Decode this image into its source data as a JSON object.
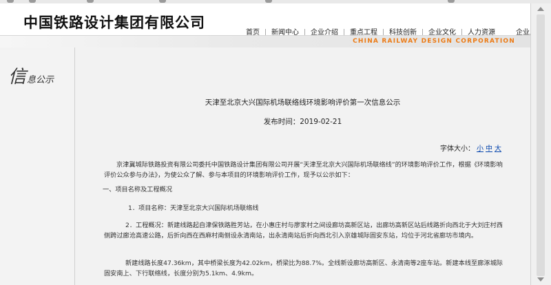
{
  "header": {
    "logo_text": "中国铁路设计集团有限公司",
    "nav": [
      "首页",
      "新闻中心",
      "企业介绍",
      "重点工程",
      "科技创新",
      "企业文化",
      "人力资源",
      "企业应用"
    ],
    "tagline": "CHINA RAILWAY DESIGN CORPORATION"
  },
  "sidebar": {
    "title_big": "信",
    "title_small": "息公示"
  },
  "article": {
    "title": "天津至北京大兴国际机场联络线环境影响评价第一次信息公示",
    "date": "发布时间：2019-02-21",
    "font_size_label": "字体大小：",
    "font_size_options": [
      "小",
      "中",
      "大"
    ],
    "paragraphs": [
      "京津冀城际铁路投资有限公司委托中国铁路设计集团有限公司开展“天津至北京大兴国际机场联络线”的环境影响评价工作，根据《环境影响评价公众参与办法》，为使公众了解、参与本项目的环境影响评价工作，现予以公示如下：",
      "一、项目名称及工程概况",
      "1．项目名称：天津至北京大兴国际机场联络线",
      "2．工程概况：新建线路起自津保铁路胜芳站，在小惠庄村与廖家村之间设廊坊高新区站，出廊坊高新区站后线路折向西北于大刘庄村西侧跨过廊沧高速公路，后折向西在西麻村南侧设永清南站，出永清南站后折向西北引入京雄城际固安东站，均位于河北省廊坊市境内。",
      "新建线路长度47.36km，其中桥梁长度为42.02km，桥梁比为88.7%。全线新设廊坊高新区、永清南等2座车站。新建本线至廊涿城际固安南上、下行联络线，长度分别为5.1km、4.9km。"
    ]
  },
  "colors": {
    "tagline": "#ec7a14",
    "link": "#0645ad",
    "content_bg": "#f2f2f2"
  }
}
